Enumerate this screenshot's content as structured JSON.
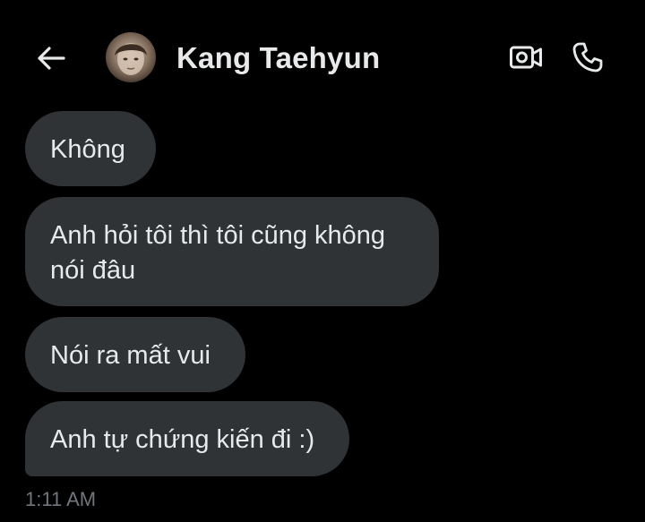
{
  "header": {
    "back_icon": "arrow-left-icon",
    "contact_name": "Kang Taehyun",
    "video_icon": "video-camera-icon",
    "call_icon": "phone-icon"
  },
  "messages": [
    {
      "text": "Không"
    },
    {
      "text": "Anh hỏi tôi thì tôi cũng không nói đâu"
    },
    {
      "text": "Nói ra mất vui"
    },
    {
      "text": "Anh tự chứng kiến đi :)"
    }
  ],
  "timestamp": "1:11 AM",
  "colors": {
    "background": "#000000",
    "bubble": "#2f3336",
    "text": "#e7e9ea",
    "muted": "#71767b"
  }
}
